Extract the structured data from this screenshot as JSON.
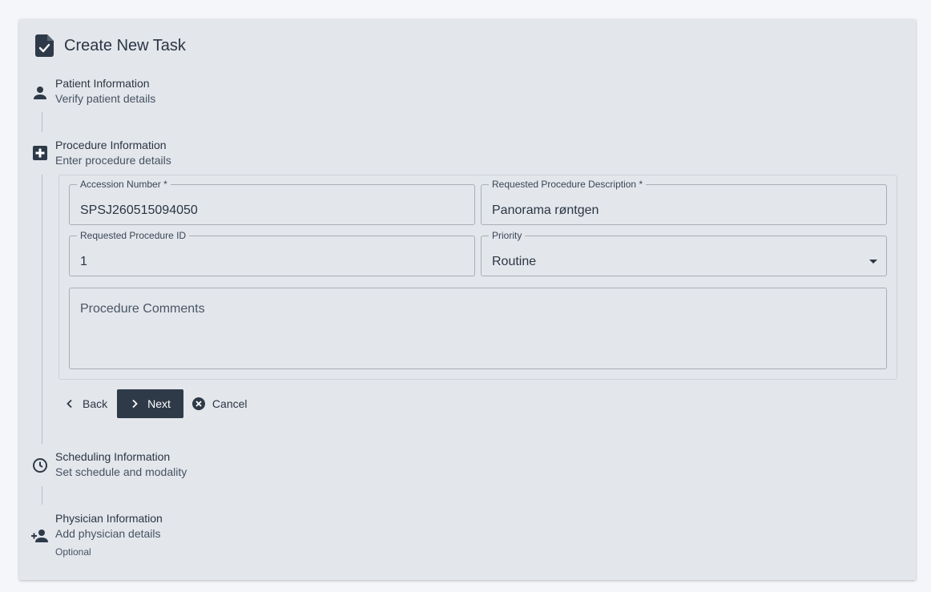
{
  "header": {
    "title": "Create New Task"
  },
  "steps": [
    {
      "title": "Patient Information",
      "subtitle": "Verify patient details",
      "icon": "person-icon"
    },
    {
      "title": "Procedure Information",
      "subtitle": "Enter procedure details",
      "icon": "medical-plus-icon"
    },
    {
      "title": "Scheduling Information",
      "subtitle": "Set schedule and modality",
      "icon": "clock-icon"
    },
    {
      "title": "Physician Information",
      "subtitle": "Add physician details",
      "optional": "Optional",
      "icon": "person-add-icon"
    }
  ],
  "form": {
    "accession": {
      "label": "Accession Number",
      "required": "*",
      "value": "SPSJ260515094050"
    },
    "description": {
      "label": "Requested Procedure Description",
      "required": "*",
      "value": "Panorama røntgen"
    },
    "procedure_id": {
      "label": "Requested Procedure ID",
      "value": "1"
    },
    "priority": {
      "label": "Priority",
      "value": "Routine"
    },
    "comments": {
      "placeholder": "Procedure Comments"
    }
  },
  "actions": {
    "back": "Back",
    "next": "Next",
    "cancel": "Cancel"
  },
  "colors": {
    "primary": "#2e3a48",
    "card_bg": "#e3e6eb",
    "page_bg": "#f5f6fa"
  }
}
